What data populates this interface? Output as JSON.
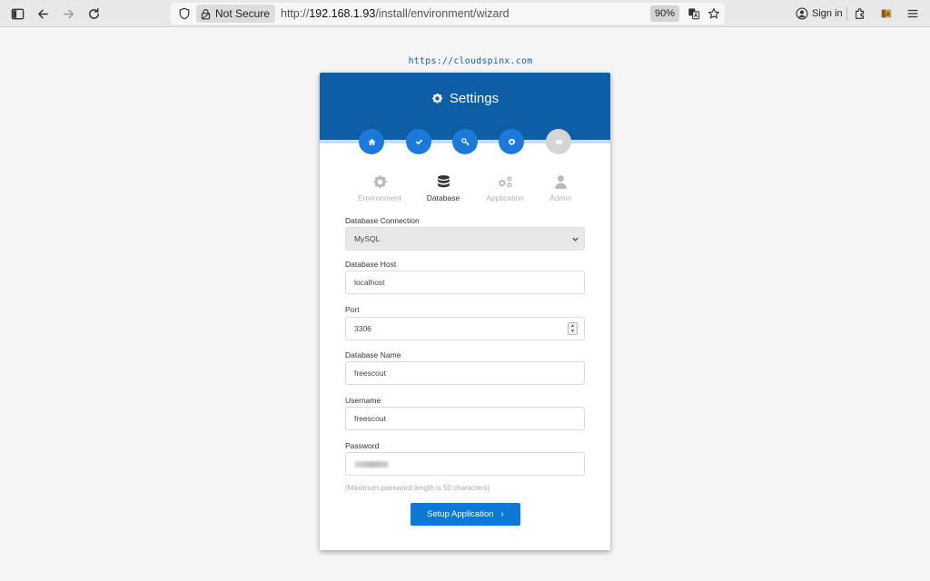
{
  "browser": {
    "security_label": "Not Secure",
    "url_scheme": "http://",
    "url_host": "192.168.1.93",
    "url_path": "/install/environment/wizard",
    "zoom": "90%",
    "signin_label": "Sign in",
    "icons": [
      "sidebar-icon",
      "back-icon",
      "forward-icon",
      "reload-icon",
      "shield-icon",
      "lock-icon",
      "translate-icon",
      "star-icon",
      "account-icon",
      "extensions-icon",
      "extension-icon",
      "menu-icon"
    ]
  },
  "watermark": "https://cloudspinx.com",
  "card": {
    "title": "Settings",
    "steps": [
      {
        "icon": "home-icon",
        "state": "done"
      },
      {
        "icon": "check-icon",
        "state": "done"
      },
      {
        "icon": "key-icon",
        "state": "done"
      },
      {
        "icon": "gear-icon",
        "state": "done"
      },
      {
        "icon": "flag-icon",
        "state": "todo"
      }
    ],
    "tabs": [
      {
        "label": "Environment",
        "icon": "gear-icon",
        "active": false
      },
      {
        "label": "Database",
        "icon": "database-icon",
        "active": true
      },
      {
        "label": "Application",
        "icon": "gears-icon",
        "active": false
      },
      {
        "label": "Admin",
        "icon": "user-icon",
        "active": false
      }
    ]
  },
  "form": {
    "connection": {
      "label": "Database Connection",
      "value": "MySQL"
    },
    "host": {
      "label": "Database Host",
      "value": "localhost"
    },
    "port": {
      "label": "Port",
      "value": "3306"
    },
    "name": {
      "label": "Database Name",
      "value": "freescout"
    },
    "username": {
      "label": "Username",
      "value": "freescout"
    },
    "password": {
      "label": "Password",
      "hint": "(Maximum password length is 50 characters)"
    },
    "submit_label": "Setup Application"
  },
  "colors": {
    "header": "#0e5ea6",
    "step_done": "#1b7ad9",
    "step_todo": "#d5d5d5",
    "button": "#0d78d6"
  }
}
